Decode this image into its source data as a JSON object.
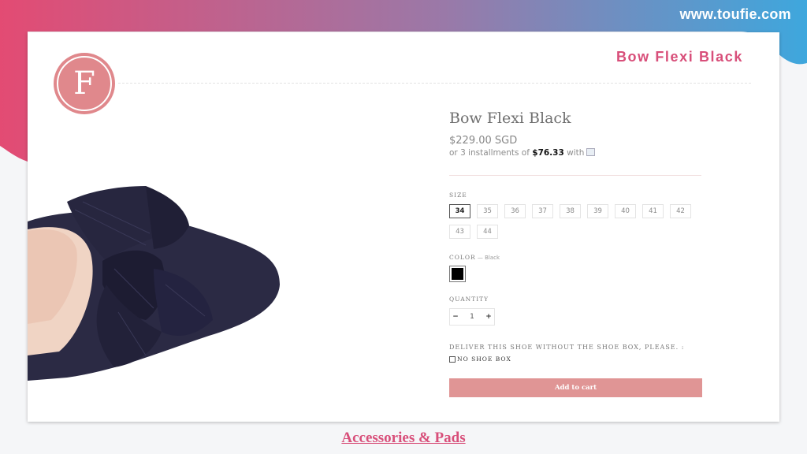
{
  "site": {
    "url": "www.toufie.com"
  },
  "header": {
    "title": "Bow Flexi Black",
    "logo_letter": "F"
  },
  "product": {
    "name": "Bow Flexi Black",
    "price": "$229.00 SGD",
    "installments_prefix": "or 3 installments of ",
    "installments_amount": "$76.33",
    "installments_suffix": " with",
    "size_label": "SIZE",
    "sizes": [
      "34",
      "35",
      "36",
      "37",
      "38",
      "39",
      "40",
      "41",
      "42",
      "43",
      "44"
    ],
    "selected_size": "34",
    "color_label": "COLOR",
    "color_separator": " — ",
    "color_value": "Black",
    "swatch_color": "#000000",
    "quantity_label": "QUANTITY",
    "quantity": {
      "minus": "−",
      "value": "1",
      "plus": "+"
    },
    "deliver_note": "DELIVER THIS SHOE WITHOUT THE SHOE BOX, PLEASE. :",
    "no_box_label": "NO SHOE BOX",
    "add_to_cart": "Add to cart"
  },
  "footer": {
    "link": "Accessories & Pads"
  },
  "colors": {
    "accent": "#d84f7a",
    "button": "#e09595",
    "logo": "#e0888c",
    "gradient_left": "#e34b73",
    "gradient_right": "#3ea7dd"
  }
}
